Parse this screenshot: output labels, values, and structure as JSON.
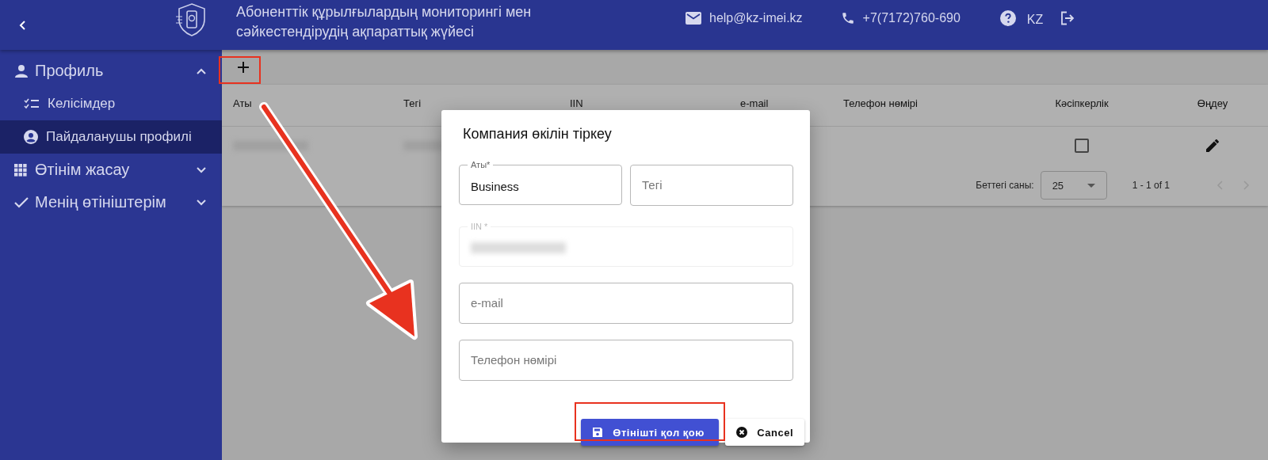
{
  "header": {
    "title_line1": "Абоненттік құрылғылардың мониторингі мен",
    "title_line2": "сәйкестендірудің ақпараттық жүйесі",
    "email": "help@kz-imei.kz",
    "phone": "+7(7172)760-690",
    "language": "KZ"
  },
  "sidebar": {
    "items": [
      {
        "label": "Профиль",
        "expanded": true,
        "children": [
          {
            "label": "Келісімдер",
            "selected": false
          },
          {
            "label": "Пайдаланушы профилі",
            "selected": true
          }
        ]
      },
      {
        "label": "Өтінім жасау",
        "expanded": false
      },
      {
        "label": "Менің өтініштерім",
        "expanded": false
      }
    ]
  },
  "table": {
    "columns": [
      "Аты",
      "Тегі",
      "IIN",
      "e-mail",
      "Телефон нөмірі",
      "Кәсіпкерлік",
      "Өңдеу"
    ],
    "rows": [
      {
        "business": false
      }
    ],
    "pagination": {
      "rows_per_page_label": "Беттегі саны:",
      "rows_per_page": "25",
      "range": "1 - 1 of 1"
    }
  },
  "dialog": {
    "title": "Компания өкілін тіркеу",
    "fields": [
      {
        "label": "Аты*",
        "value": "Business",
        "disabled": false
      },
      {
        "placeholder": "Тегі",
        "disabled": false
      },
      {
        "label": "IIN *",
        "disabled": true,
        "redacted": true
      },
      {
        "placeholder": "e-mail",
        "disabled": false
      },
      {
        "placeholder": "Телефон нөмірі",
        "disabled": false
      }
    ],
    "submit": "Өтінішті қол қою",
    "cancel": "Cancel"
  }
}
